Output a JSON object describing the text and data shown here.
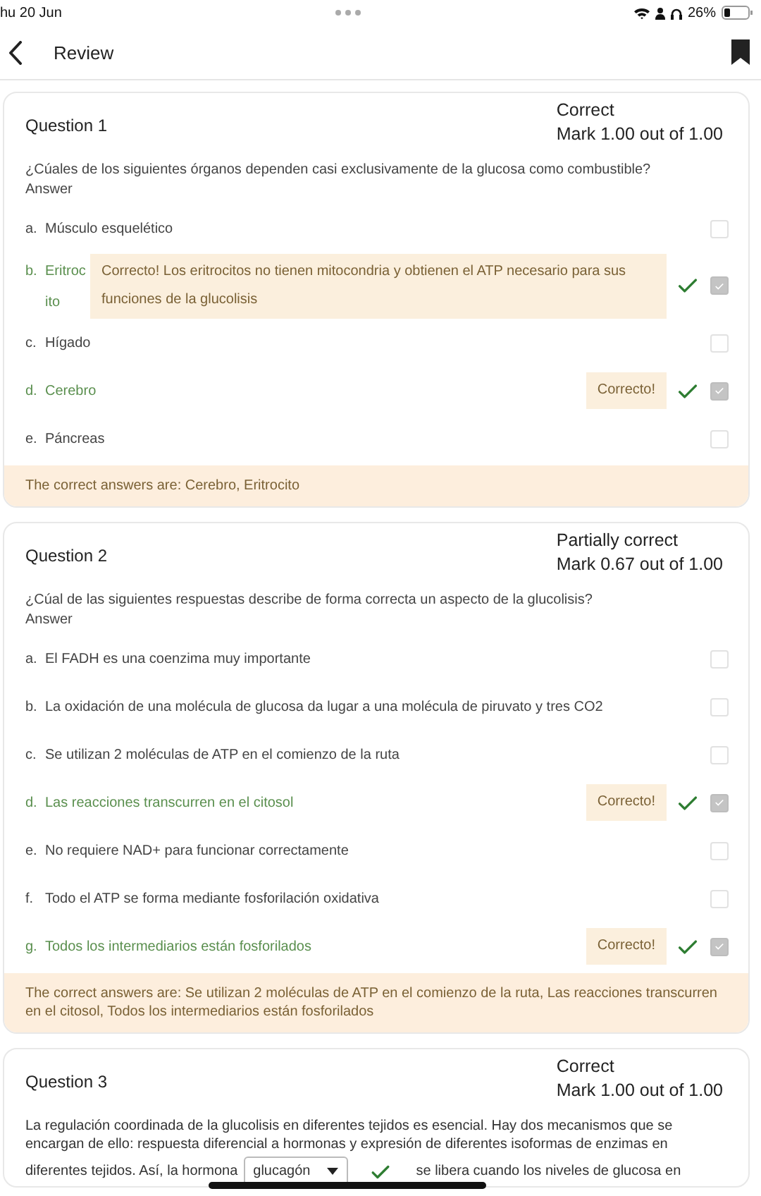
{
  "status_bar": {
    "date": "hu 20 Jun",
    "battery": "26%"
  },
  "header": {
    "title": "Review"
  },
  "questions": [
    {
      "kind": "multichoice",
      "title": "Question 1",
      "state": "Correct",
      "mark": "Mark 1.00 out of 1.00",
      "prompt": "¿Cúales de los siguientes órganos dependen casi exclusivamente de la glucosa como combustible?",
      "answer_label": "Answer",
      "options": [
        {
          "letter": "a.",
          "text": "Músculo esquelético",
          "checked": false,
          "correct": false
        },
        {
          "letter": "b.",
          "text": "Eritrocito",
          "checked": true,
          "correct": true,
          "feedback": "Correcto! Los eritrocitos no tienen mitocondria y obtienen el ATP necesario para sus funciones de la glucolisis"
        },
        {
          "letter": "c.",
          "text": "Hígado",
          "checked": false,
          "correct": false
        },
        {
          "letter": "d.",
          "text": "Cerebro",
          "checked": true,
          "correct": true,
          "feedback": "Correcto!"
        },
        {
          "letter": "e.",
          "text": "Páncreas",
          "checked": false,
          "correct": false
        }
      ],
      "correct_answer": "The correct answers are: Cerebro, Eritrocito"
    },
    {
      "kind": "multichoice",
      "title": "Question 2",
      "state": "Partially correct",
      "mark": "Mark 0.67 out of 1.00",
      "prompt": "¿Cúal de las siguientes respuestas describe de forma correcta un aspecto de la glucolisis?",
      "answer_label": "Answer",
      "options": [
        {
          "letter": "a.",
          "text": "El FADH es una coenzima muy importante",
          "checked": false,
          "correct": false
        },
        {
          "letter": "b.",
          "text": "La oxidación de una molécula de glucosa da lugar a una molécula de piruvato y tres CO2",
          "checked": false,
          "correct": false
        },
        {
          "letter": "c.",
          "text": "Se utilizan 2 moléculas de ATP en el comienzo de la ruta",
          "checked": false,
          "correct": false
        },
        {
          "letter": "d.",
          "text": "Las reacciones transcurren en el citosol",
          "checked": true,
          "correct": true,
          "feedback": "Correcto!"
        },
        {
          "letter": "e.",
          "text": "No requiere NAD+ para funcionar correctamente",
          "checked": false,
          "correct": false
        },
        {
          "letter": "f.",
          "text": "Todo el ATP se forma mediante fosforilación oxidativa",
          "checked": false,
          "correct": false
        },
        {
          "letter": "g.",
          "text": "Todos los intermediarios están fosforilados",
          "checked": true,
          "correct": true,
          "feedback": "Correcto!"
        }
      ],
      "correct_answer": "The correct answers are: Se utilizan 2 moléculas de ATP en el comienzo de la ruta, Las reacciones transcurren en el citosol, Todos los intermediarios están fosforilados"
    },
    {
      "kind": "cloze",
      "title": "Question 3",
      "state": "Correct",
      "mark": "Mark 1.00 out of 1.00",
      "parts": [
        {
          "kind": "text",
          "text": "La regulación coordinada de la glucolisis en diferentes tejidos es esencial. Hay dos mecanismos que se encargan de ello: respuesta diferencial a hormonas y expresión de diferentes isoformas de enzimas en"
        },
        {
          "kind": "text",
          "text": "diferentes tejidos. Así, la hormona"
        },
        {
          "kind": "select",
          "value": "glucagón",
          "correct": true
        },
        {
          "kind": "text",
          "text": "se libera cuando los niveles de glucosa en"
        }
      ]
    }
  ]
}
